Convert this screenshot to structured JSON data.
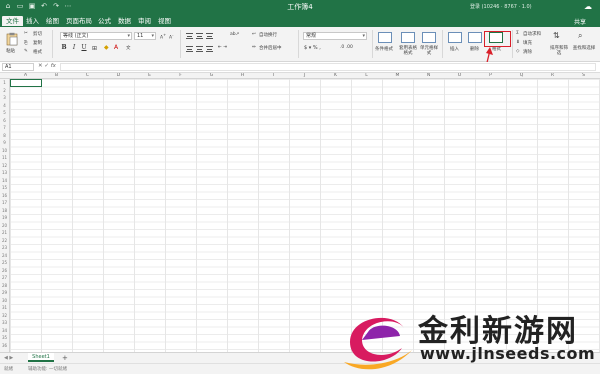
{
  "titlebar": {
    "title": "工作簿4",
    "account": "登录 (10246 · 8767 · 1.0)",
    "quick_access": [
      "home-icon",
      "folder-icon",
      "save-icon",
      "undo-icon",
      "redo-icon",
      "more-icon"
    ]
  },
  "menu": {
    "tabs": [
      "文件",
      "插入",
      "绘图",
      "页面布局",
      "公式",
      "数据",
      "审阅",
      "视图"
    ],
    "active_index": 0,
    "share": "共享"
  },
  "ribbon": {
    "clipboard": {
      "paste": "粘贴",
      "cut": "剪切",
      "copy": "复制",
      "format_painter": "格式"
    },
    "font": {
      "name": "等线 (正文)",
      "size": "11",
      "bold": "B",
      "italic": "I",
      "underline": "U"
    },
    "alignment": {
      "wrap": "自动换行",
      "merge": "合并后居中"
    },
    "number": {
      "format": "常规"
    },
    "styles": {
      "conditional": "条件格式",
      "table": "套用表格格式",
      "cell_styles": "单元格样式"
    },
    "cells": {
      "insert": "插入",
      "delete": "删除",
      "format": "格式"
    },
    "editing": {
      "autosum": "自动求和",
      "fill": "填充",
      "clear": "清除",
      "sort": "排序和筛选",
      "find": "查找和选择"
    }
  },
  "formula_bar": {
    "name_box": "A1",
    "fx": "fx",
    "value": ""
  },
  "grid": {
    "columns": [
      "A",
      "B",
      "C",
      "D",
      "E",
      "F",
      "G",
      "H",
      "I",
      "J",
      "K",
      "L",
      "M",
      "N",
      "O",
      "P",
      "Q",
      "R",
      "S"
    ],
    "rows": [
      "1",
      "2",
      "3",
      "4",
      "5",
      "6",
      "7",
      "8",
      "9",
      "10",
      "11",
      "12",
      "13",
      "14",
      "15",
      "16",
      "17",
      "18",
      "19",
      "20",
      "21",
      "22",
      "23",
      "24",
      "25",
      "26",
      "27",
      "28",
      "29",
      "30",
      "31",
      "32",
      "33",
      "34",
      "35",
      "36"
    ]
  },
  "sheets": {
    "tabs": [
      "Sheet1"
    ],
    "add": "+"
  },
  "status": {
    "ready": "就绪",
    "accessibility": "辅助功能: 一切就绪"
  },
  "watermark": {
    "text": "金利新游网",
    "url": "www.jlnseeds.com"
  },
  "colors": {
    "accent": "#217346",
    "highlight": "#d9202a"
  }
}
